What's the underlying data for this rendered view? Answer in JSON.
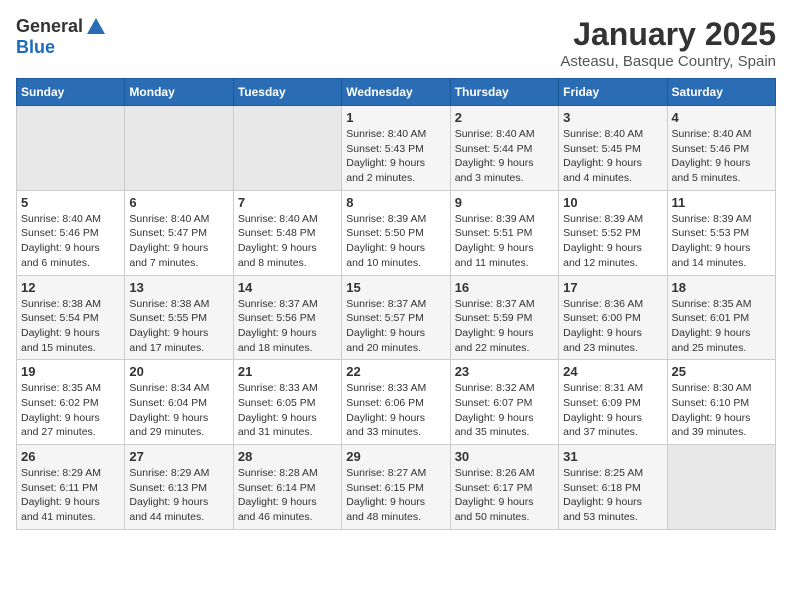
{
  "header": {
    "logo_general": "General",
    "logo_blue": "Blue",
    "month_title": "January 2025",
    "location": "Asteasu, Basque Country, Spain"
  },
  "days_of_week": [
    "Sunday",
    "Monday",
    "Tuesday",
    "Wednesday",
    "Thursday",
    "Friday",
    "Saturday"
  ],
  "weeks": [
    [
      {
        "day": "",
        "info": ""
      },
      {
        "day": "",
        "info": ""
      },
      {
        "day": "",
        "info": ""
      },
      {
        "day": "1",
        "info": "Sunrise: 8:40 AM\nSunset: 5:43 PM\nDaylight: 9 hours\nand 2 minutes."
      },
      {
        "day": "2",
        "info": "Sunrise: 8:40 AM\nSunset: 5:44 PM\nDaylight: 9 hours\nand 3 minutes."
      },
      {
        "day": "3",
        "info": "Sunrise: 8:40 AM\nSunset: 5:45 PM\nDaylight: 9 hours\nand 4 minutes."
      },
      {
        "day": "4",
        "info": "Sunrise: 8:40 AM\nSunset: 5:46 PM\nDaylight: 9 hours\nand 5 minutes."
      }
    ],
    [
      {
        "day": "5",
        "info": "Sunrise: 8:40 AM\nSunset: 5:46 PM\nDaylight: 9 hours\nand 6 minutes."
      },
      {
        "day": "6",
        "info": "Sunrise: 8:40 AM\nSunset: 5:47 PM\nDaylight: 9 hours\nand 7 minutes."
      },
      {
        "day": "7",
        "info": "Sunrise: 8:40 AM\nSunset: 5:48 PM\nDaylight: 9 hours\nand 8 minutes."
      },
      {
        "day": "8",
        "info": "Sunrise: 8:39 AM\nSunset: 5:50 PM\nDaylight: 9 hours\nand 10 minutes."
      },
      {
        "day": "9",
        "info": "Sunrise: 8:39 AM\nSunset: 5:51 PM\nDaylight: 9 hours\nand 11 minutes."
      },
      {
        "day": "10",
        "info": "Sunrise: 8:39 AM\nSunset: 5:52 PM\nDaylight: 9 hours\nand 12 minutes."
      },
      {
        "day": "11",
        "info": "Sunrise: 8:39 AM\nSunset: 5:53 PM\nDaylight: 9 hours\nand 14 minutes."
      }
    ],
    [
      {
        "day": "12",
        "info": "Sunrise: 8:38 AM\nSunset: 5:54 PM\nDaylight: 9 hours\nand 15 minutes."
      },
      {
        "day": "13",
        "info": "Sunrise: 8:38 AM\nSunset: 5:55 PM\nDaylight: 9 hours\nand 17 minutes."
      },
      {
        "day": "14",
        "info": "Sunrise: 8:37 AM\nSunset: 5:56 PM\nDaylight: 9 hours\nand 18 minutes."
      },
      {
        "day": "15",
        "info": "Sunrise: 8:37 AM\nSunset: 5:57 PM\nDaylight: 9 hours\nand 20 minutes."
      },
      {
        "day": "16",
        "info": "Sunrise: 8:37 AM\nSunset: 5:59 PM\nDaylight: 9 hours\nand 22 minutes."
      },
      {
        "day": "17",
        "info": "Sunrise: 8:36 AM\nSunset: 6:00 PM\nDaylight: 9 hours\nand 23 minutes."
      },
      {
        "day": "18",
        "info": "Sunrise: 8:35 AM\nSunset: 6:01 PM\nDaylight: 9 hours\nand 25 minutes."
      }
    ],
    [
      {
        "day": "19",
        "info": "Sunrise: 8:35 AM\nSunset: 6:02 PM\nDaylight: 9 hours\nand 27 minutes."
      },
      {
        "day": "20",
        "info": "Sunrise: 8:34 AM\nSunset: 6:04 PM\nDaylight: 9 hours\nand 29 minutes."
      },
      {
        "day": "21",
        "info": "Sunrise: 8:33 AM\nSunset: 6:05 PM\nDaylight: 9 hours\nand 31 minutes."
      },
      {
        "day": "22",
        "info": "Sunrise: 8:33 AM\nSunset: 6:06 PM\nDaylight: 9 hours\nand 33 minutes."
      },
      {
        "day": "23",
        "info": "Sunrise: 8:32 AM\nSunset: 6:07 PM\nDaylight: 9 hours\nand 35 minutes."
      },
      {
        "day": "24",
        "info": "Sunrise: 8:31 AM\nSunset: 6:09 PM\nDaylight: 9 hours\nand 37 minutes."
      },
      {
        "day": "25",
        "info": "Sunrise: 8:30 AM\nSunset: 6:10 PM\nDaylight: 9 hours\nand 39 minutes."
      }
    ],
    [
      {
        "day": "26",
        "info": "Sunrise: 8:29 AM\nSunset: 6:11 PM\nDaylight: 9 hours\nand 41 minutes."
      },
      {
        "day": "27",
        "info": "Sunrise: 8:29 AM\nSunset: 6:13 PM\nDaylight: 9 hours\nand 44 minutes."
      },
      {
        "day": "28",
        "info": "Sunrise: 8:28 AM\nSunset: 6:14 PM\nDaylight: 9 hours\nand 46 minutes."
      },
      {
        "day": "29",
        "info": "Sunrise: 8:27 AM\nSunset: 6:15 PM\nDaylight: 9 hours\nand 48 minutes."
      },
      {
        "day": "30",
        "info": "Sunrise: 8:26 AM\nSunset: 6:17 PM\nDaylight: 9 hours\nand 50 minutes."
      },
      {
        "day": "31",
        "info": "Sunrise: 8:25 AM\nSunset: 6:18 PM\nDaylight: 9 hours\nand 53 minutes."
      },
      {
        "day": "",
        "info": ""
      }
    ]
  ]
}
